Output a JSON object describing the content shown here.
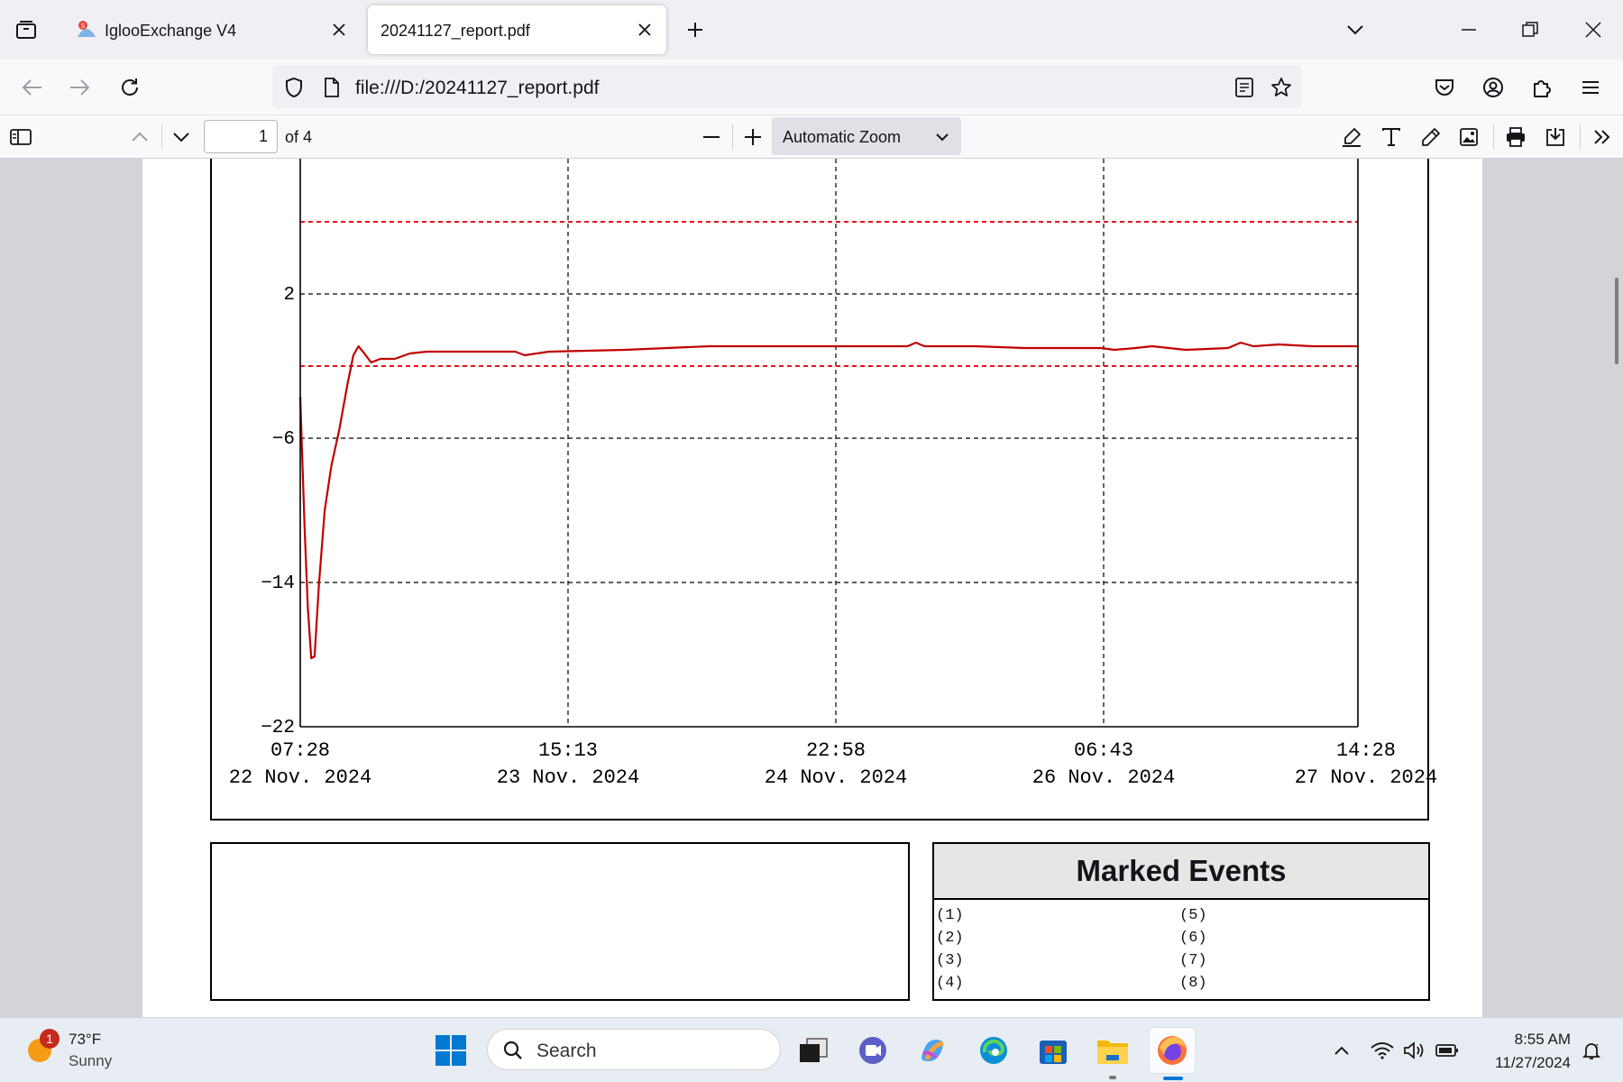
{
  "tabs": [
    {
      "title": "IglooExchange V4"
    },
    {
      "title": "20241127_report.pdf"
    }
  ],
  "address_bar": {
    "url": "file:///D:/20241127_report.pdf"
  },
  "pdf_toolbar": {
    "page_current": "1",
    "page_of": "of 4",
    "zoom": "Automatic Zoom"
  },
  "chart_data": {
    "type": "line",
    "title": "",
    "xlabel": "",
    "ylabel": "",
    "y_ticks": [
      "2",
      "−6",
      "−14",
      "−22"
    ],
    "y_tick_values": [
      2,
      -6,
      -14,
      -22
    ],
    "ylim": [
      -22,
      9
    ],
    "x_ticks": [
      {
        "time": "07:28",
        "date": "22 Nov. 2024"
      },
      {
        "time": "15:13",
        "date": "23 Nov. 2024"
      },
      {
        "time": "22:58",
        "date": "24 Nov. 2024"
      },
      {
        "time": "06:43",
        "date": "26 Nov. 2024"
      },
      {
        "time": "14:28",
        "date": "27 Nov. 2024"
      }
    ],
    "x_tick_hours": [
      0,
      31.75,
      63.5,
      95.25,
      127
    ],
    "xlim_hours": [
      0,
      125.4
    ],
    "grid": true,
    "reference_lines": [
      6.0,
      -2.0
    ],
    "series": [
      {
        "color": "#c00000",
        "points": [
          [
            0,
            -3.7
          ],
          [
            0.5,
            -10.8
          ],
          [
            0.9,
            -15.4
          ],
          [
            1.3,
            -18.2
          ],
          [
            1.7,
            -18.1
          ],
          [
            2.2,
            -14.2
          ],
          [
            2.9,
            -10.0
          ],
          [
            3.7,
            -7.5
          ],
          [
            4.6,
            -5.6
          ],
          [
            5.6,
            -3.0
          ],
          [
            6.3,
            -1.4
          ],
          [
            6.9,
            -0.9
          ],
          [
            7.6,
            -1.3
          ],
          [
            8.4,
            -1.8
          ],
          [
            9.5,
            -1.6
          ],
          [
            11.2,
            -1.6
          ],
          [
            13.0,
            -1.3
          ],
          [
            15.0,
            -1.2
          ],
          [
            20.0,
            -1.2
          ],
          [
            25.5,
            -1.2
          ],
          [
            26.6,
            -1.4
          ],
          [
            29.5,
            -1.2
          ],
          [
            38.5,
            -1.1
          ],
          [
            48.5,
            -0.9
          ],
          [
            60,
            -0.9
          ],
          [
            72,
            -0.9
          ],
          [
            73.0,
            -0.7
          ],
          [
            74.0,
            -0.9
          ],
          [
            80,
            -0.9
          ],
          [
            86,
            -1.0
          ],
          [
            95,
            -1.0
          ],
          [
            96.5,
            -1.1
          ],
          [
            99,
            -1.0
          ],
          [
            101,
            -0.9
          ],
          [
            105,
            -1.1
          ],
          [
            110,
            -1.0
          ],
          [
            111.5,
            -0.7
          ],
          [
            113,
            -0.9
          ],
          [
            116,
            -0.8
          ],
          [
            120,
            -0.9
          ],
          [
            125.4,
            -0.9
          ]
        ]
      }
    ]
  },
  "marked_events": {
    "title": "Marked Events",
    "left": [
      "(1)",
      "(2)",
      "(3)",
      "(4)"
    ],
    "right": [
      "(5)",
      "(6)",
      "(7)",
      "(8)"
    ]
  },
  "taskbar": {
    "weather_temp": "73°F",
    "weather_desc": "Sunny",
    "weather_badge": "1",
    "search_placeholder": "Search",
    "time": "8:55 AM",
    "date": "11/27/2024"
  },
  "colors": {
    "accent": "#0078d4",
    "firefox": "#ff7139",
    "plot_line": "#c00000"
  }
}
